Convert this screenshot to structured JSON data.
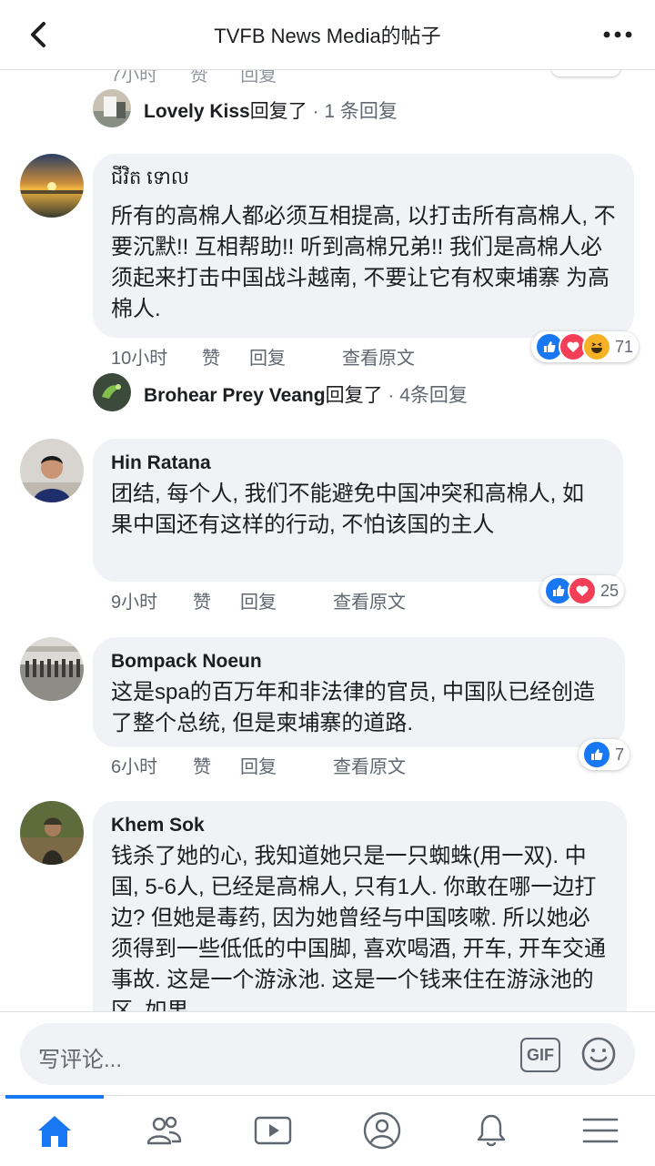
{
  "header": {
    "title": "TVFB News Media的帖子"
  },
  "partial_top": {
    "time": "7小时",
    "like": "赞",
    "reply": "回复"
  },
  "replies": [
    {
      "name": "Lovely Kiss",
      "suffix": "回复了",
      "count": " · 1 条回复"
    },
    {
      "name": "Brohear Prey Veang",
      "suffix": "回复了",
      "count": " · 4条回复"
    }
  ],
  "comments": [
    {
      "name": "ជីវិត ទោល",
      "text": "所有的高棉人都必须互相提高, 以打击所有高棉人, 不要沉默!! 互相帮助!! 听到高棉兄弟!! 我们是高棉人必须起来打击中国战斗越南, 不要让它有权柬埔寨 为高棉人.",
      "time": "10小时",
      "like": "赞",
      "reply": "回复",
      "see_original": "查看原文",
      "reactions": [
        "like",
        "love",
        "haha"
      ],
      "reaction_count": "71"
    },
    {
      "name": "Hin Ratana",
      "text": "团结, 每个人, 我们不能避免中国冲突和高棉人, 如果中国还有这样的行动, 不怕该国的主人",
      "time": "9小时",
      "like": "赞",
      "reply": "回复",
      "see_original": "查看原文",
      "reactions": [
        "like",
        "love"
      ],
      "reaction_count": "25"
    },
    {
      "name": "Bompack Noeun",
      "text": "这是spa的百万年和非法律的官员, 中国队已经创造了整个总统, 但是柬埔寨的道路.",
      "time": "6小时",
      "like": "赞",
      "reply": "回复",
      "see_original": "查看原文",
      "reactions": [
        "like"
      ],
      "reaction_count": "7"
    },
    {
      "name": "Khem Sok",
      "text": "钱杀了她的心, 我知道她只是一只蜘蛛(用一双). 中国, 5-6人, 已经是高棉人, 只有1人. 你敢在哪一边打边? 但她是毒药, 因为她曾经与中国咳嗽. 所以她必须得到一些低低的中国脚, 喜欢喝酒, 开车, 开车交通事故. 这是一个游泳池. 这是一个钱来住在游泳池的区. 如果"
    }
  ],
  "composer": {
    "placeholder": "写评论...",
    "gif_label": "GIF"
  },
  "tabs": [
    "home-icon",
    "friends-icon",
    "watch-icon",
    "profile-icon",
    "notifications-icon",
    "menu-icon"
  ],
  "colors": {
    "accent": "#1877f2",
    "bubble": "#f0f2f5",
    "love": "#f33e58",
    "haha": "#f7b125"
  }
}
